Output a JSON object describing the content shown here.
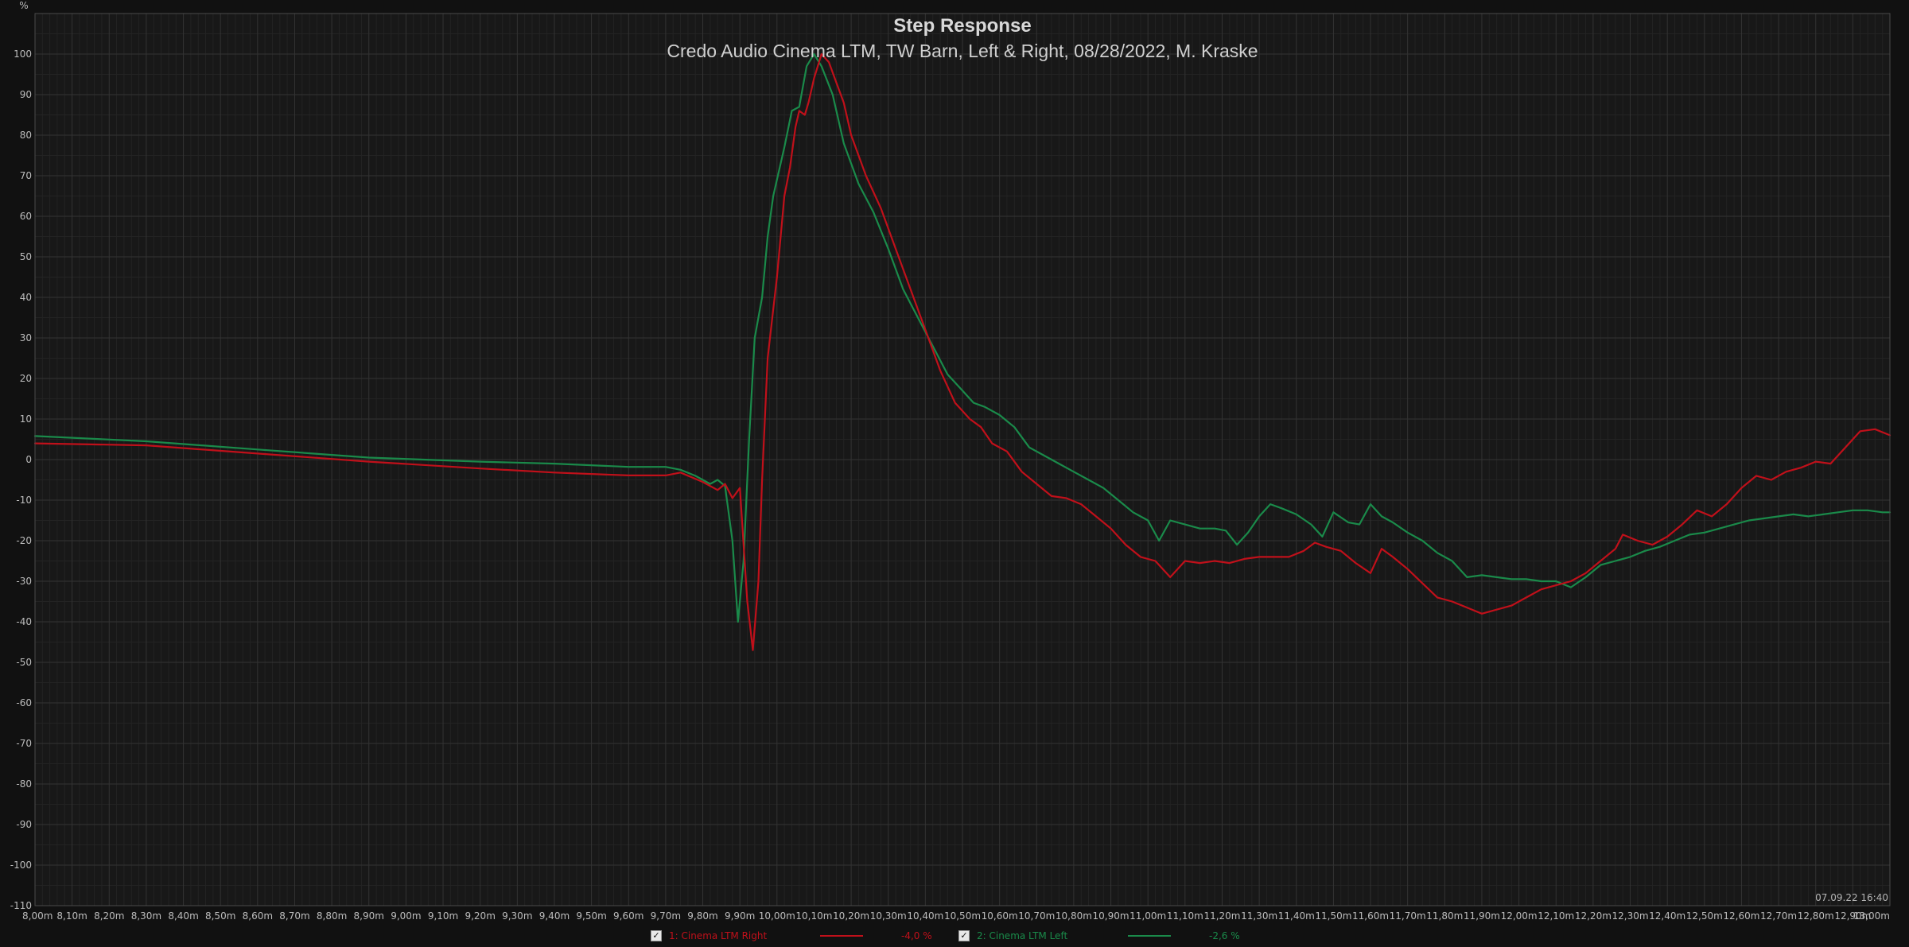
{
  "chart_data": {
    "type": "line",
    "title": "Step Response",
    "subtitle": "Credo Audio Cinema LTM, TW Barn, Left & Right, 08/28/2022, M. Kraske",
    "ylabel": "%",
    "xlabel": "",
    "xlim": [
      8.0,
      13.0
    ],
    "ylim": [
      -110,
      110
    ],
    "x_unit": "m",
    "x_ticks": [
      "8,00m",
      "8,10m",
      "8,20m",
      "8,30m",
      "8,40m",
      "8,50m",
      "8,60m",
      "8,70m",
      "8,80m",
      "8,90m",
      "9,00m",
      "9,10m",
      "9,20m",
      "9,30m",
      "9,40m",
      "9,50m",
      "9,60m",
      "9,70m",
      "9,80m",
      "9,90m",
      "10,00m",
      "10,10m",
      "10,20m",
      "10,30m",
      "10,40m",
      "10,50m",
      "10,60m",
      "10,70m",
      "10,80m",
      "10,90m",
      "11,00m",
      "11,10m",
      "11,20m",
      "11,30m",
      "11,40m",
      "11,50m",
      "11,60m",
      "11,70m",
      "11,80m",
      "11,90m",
      "12,00m",
      "12,10m",
      "12,20m",
      "12,30m",
      "12,40m",
      "12,50m",
      "12,60m",
      "12,70m",
      "12,80m",
      "12,90m",
      "13,00m"
    ],
    "y_ticks": [
      "100",
      "90",
      "80",
      "70",
      "60",
      "50",
      "40",
      "30",
      "20",
      "10",
      "0",
      "-10",
      "-20",
      "-30",
      "-40",
      "-50",
      "-60",
      "-70",
      "-80",
      "-90",
      "-100",
      "-110"
    ],
    "grid": true,
    "timestamp": "07.09.22 16:40",
    "series": [
      {
        "name": "1: Cinema LTM Right",
        "value_label": "-4,0 %",
        "color": "#c0101a",
        "points": [
          [
            8.0,
            4.0
          ],
          [
            8.3,
            3.5
          ],
          [
            8.6,
            1.5
          ],
          [
            8.9,
            -0.5
          ],
          [
            9.2,
            -2.2
          ],
          [
            9.4,
            -3.2
          ],
          [
            9.6,
            -3.9
          ],
          [
            9.7,
            -3.9
          ],
          [
            9.74,
            -3.2
          ],
          [
            9.8,
            -5.5
          ],
          [
            9.84,
            -7.5
          ],
          [
            9.86,
            -6.0
          ],
          [
            9.88,
            -9.5
          ],
          [
            9.9,
            -7.0
          ],
          [
            9.92,
            -35.0
          ],
          [
            9.935,
            -47.0
          ],
          [
            9.95,
            -30.0
          ],
          [
            9.96,
            -5.0
          ],
          [
            9.975,
            25.0
          ],
          [
            9.99,
            37.0
          ],
          [
            10.0,
            45.0
          ],
          [
            10.02,
            65.0
          ],
          [
            10.035,
            72.0
          ],
          [
            10.05,
            82.0
          ],
          [
            10.06,
            86.0
          ],
          [
            10.075,
            85.0
          ],
          [
            10.085,
            88.0
          ],
          [
            10.1,
            94.0
          ],
          [
            10.12,
            100.0
          ],
          [
            10.14,
            98.0
          ],
          [
            10.16,
            93.0
          ],
          [
            10.18,
            88.0
          ],
          [
            10.2,
            80.0
          ],
          [
            10.24,
            70.0
          ],
          [
            10.28,
            62.0
          ],
          [
            10.32,
            52.0
          ],
          [
            10.36,
            42.0
          ],
          [
            10.4,
            32.0
          ],
          [
            10.44,
            22.0
          ],
          [
            10.48,
            14.0
          ],
          [
            10.52,
            10.0
          ],
          [
            10.55,
            8.0
          ],
          [
            10.58,
            4.0
          ],
          [
            10.62,
            2.0
          ],
          [
            10.66,
            -3.0
          ],
          [
            10.7,
            -6.0
          ],
          [
            10.74,
            -9.0
          ],
          [
            10.78,
            -9.5
          ],
          [
            10.82,
            -11.0
          ],
          [
            10.86,
            -14.0
          ],
          [
            10.9,
            -17.0
          ],
          [
            10.94,
            -21.0
          ],
          [
            10.98,
            -24.0
          ],
          [
            11.02,
            -25.0
          ],
          [
            11.06,
            -29.0
          ],
          [
            11.1,
            -25.0
          ],
          [
            11.14,
            -25.5
          ],
          [
            11.18,
            -25.0
          ],
          [
            11.22,
            -25.5
          ],
          [
            11.26,
            -24.5
          ],
          [
            11.3,
            -24.0
          ],
          [
            11.34,
            -24.0
          ],
          [
            11.38,
            -24.0
          ],
          [
            11.42,
            -22.5
          ],
          [
            11.45,
            -20.5
          ],
          [
            11.48,
            -21.5
          ],
          [
            11.52,
            -22.5
          ],
          [
            11.56,
            -25.5
          ],
          [
            11.6,
            -28.0
          ],
          [
            11.63,
            -22.0
          ],
          [
            11.66,
            -24.0
          ],
          [
            11.7,
            -27.0
          ],
          [
            11.74,
            -30.5
          ],
          [
            11.78,
            -34.0
          ],
          [
            11.82,
            -35.0
          ],
          [
            11.86,
            -36.5
          ],
          [
            11.9,
            -38.0
          ],
          [
            11.94,
            -37.0
          ],
          [
            11.98,
            -36.0
          ],
          [
            12.02,
            -34.0
          ],
          [
            12.06,
            -32.0
          ],
          [
            12.1,
            -31.0
          ],
          [
            12.14,
            -30.0
          ],
          [
            12.18,
            -28.0
          ],
          [
            12.22,
            -25.0
          ],
          [
            12.26,
            -22.0
          ],
          [
            12.28,
            -18.5
          ],
          [
            12.32,
            -20.0
          ],
          [
            12.36,
            -21.0
          ],
          [
            12.4,
            -19.0
          ],
          [
            12.44,
            -16.0
          ],
          [
            12.48,
            -12.5
          ],
          [
            12.52,
            -14.0
          ],
          [
            12.56,
            -11.0
          ],
          [
            12.6,
            -7.0
          ],
          [
            12.64,
            -4.0
          ],
          [
            12.68,
            -5.0
          ],
          [
            12.72,
            -3.0
          ],
          [
            12.76,
            -2.0
          ],
          [
            12.8,
            -0.5
          ],
          [
            12.84,
            -1.0
          ],
          [
            12.88,
            3.0
          ],
          [
            12.92,
            7.0
          ],
          [
            12.96,
            7.5
          ],
          [
            13.0,
            6.0
          ]
        ]
      },
      {
        "name": "2: Cinema LTM Left",
        "value_label": "-2,6 %",
        "color": "#1a8a4a",
        "points": [
          [
            8.0,
            5.8
          ],
          [
            8.3,
            4.5
          ],
          [
            8.6,
            2.5
          ],
          [
            8.9,
            0.5
          ],
          [
            9.2,
            -0.5
          ],
          [
            9.4,
            -1.0
          ],
          [
            9.6,
            -1.8
          ],
          [
            9.7,
            -1.8
          ],
          [
            9.74,
            -2.5
          ],
          [
            9.78,
            -4.0
          ],
          [
            9.82,
            -6.0
          ],
          [
            9.84,
            -5.0
          ],
          [
            9.86,
            -6.5
          ],
          [
            9.88,
            -20.0
          ],
          [
            9.895,
            -40.0
          ],
          [
            9.91,
            -25.0
          ],
          [
            9.925,
            5.0
          ],
          [
            9.94,
            30.0
          ],
          [
            9.96,
            40.0
          ],
          [
            9.975,
            55.0
          ],
          [
            9.99,
            65.0
          ],
          [
            10.02,
            77.0
          ],
          [
            10.04,
            86.0
          ],
          [
            10.06,
            87.0
          ],
          [
            10.08,
            97.0
          ],
          [
            10.1,
            100.0
          ],
          [
            10.12,
            97.0
          ],
          [
            10.15,
            90.0
          ],
          [
            10.18,
            78.0
          ],
          [
            10.22,
            68.0
          ],
          [
            10.26,
            61.0
          ],
          [
            10.3,
            52.0
          ],
          [
            10.34,
            42.0
          ],
          [
            10.38,
            35.0
          ],
          [
            10.42,
            28.0
          ],
          [
            10.46,
            21.0
          ],
          [
            10.5,
            17.0
          ],
          [
            10.53,
            14.0
          ],
          [
            10.56,
            13.0
          ],
          [
            10.6,
            11.0
          ],
          [
            10.64,
            8.0
          ],
          [
            10.68,
            3.0
          ],
          [
            10.72,
            1.0
          ],
          [
            10.76,
            -1.0
          ],
          [
            10.8,
            -3.0
          ],
          [
            10.84,
            -5.0
          ],
          [
            10.88,
            -7.0
          ],
          [
            10.92,
            -10.0
          ],
          [
            10.96,
            -13.0
          ],
          [
            11.0,
            -15.0
          ],
          [
            11.03,
            -20.0
          ],
          [
            11.06,
            -15.0
          ],
          [
            11.1,
            -16.0
          ],
          [
            11.14,
            -17.0
          ],
          [
            11.18,
            -17.0
          ],
          [
            11.21,
            -17.5
          ],
          [
            11.24,
            -21.0
          ],
          [
            11.27,
            -18.0
          ],
          [
            11.3,
            -14.0
          ],
          [
            11.33,
            -11.0
          ],
          [
            11.36,
            -12.0
          ],
          [
            11.4,
            -13.5
          ],
          [
            11.44,
            -16.0
          ],
          [
            11.47,
            -19.0
          ],
          [
            11.5,
            -13.0
          ],
          [
            11.54,
            -15.5
          ],
          [
            11.57,
            -16.0
          ],
          [
            11.6,
            -11.0
          ],
          [
            11.63,
            -14.0
          ],
          [
            11.66,
            -15.5
          ],
          [
            11.7,
            -18.0
          ],
          [
            11.74,
            -20.0
          ],
          [
            11.78,
            -23.0
          ],
          [
            11.82,
            -25.0
          ],
          [
            11.86,
            -29.0
          ],
          [
            11.9,
            -28.5
          ],
          [
            11.94,
            -29.0
          ],
          [
            11.98,
            -29.5
          ],
          [
            12.02,
            -29.5
          ],
          [
            12.06,
            -30.0
          ],
          [
            12.1,
            -30.0
          ],
          [
            12.14,
            -31.5
          ],
          [
            12.18,
            -29.0
          ],
          [
            12.22,
            -26.0
          ],
          [
            12.26,
            -25.0
          ],
          [
            12.3,
            -24.0
          ],
          [
            12.34,
            -22.5
          ],
          [
            12.38,
            -21.5
          ],
          [
            12.42,
            -20.0
          ],
          [
            12.46,
            -18.5
          ],
          [
            12.5,
            -18.0
          ],
          [
            12.54,
            -17.0
          ],
          [
            12.58,
            -16.0
          ],
          [
            12.62,
            -15.0
          ],
          [
            12.66,
            -14.5
          ],
          [
            12.7,
            -14.0
          ],
          [
            12.74,
            -13.5
          ],
          [
            12.78,
            -14.0
          ],
          [
            12.82,
            -13.5
          ],
          [
            12.86,
            -13.0
          ],
          [
            12.9,
            -12.5
          ],
          [
            12.94,
            -12.5
          ],
          [
            12.98,
            -13.0
          ],
          [
            13.0,
            -13.0
          ]
        ]
      }
    ]
  }
}
